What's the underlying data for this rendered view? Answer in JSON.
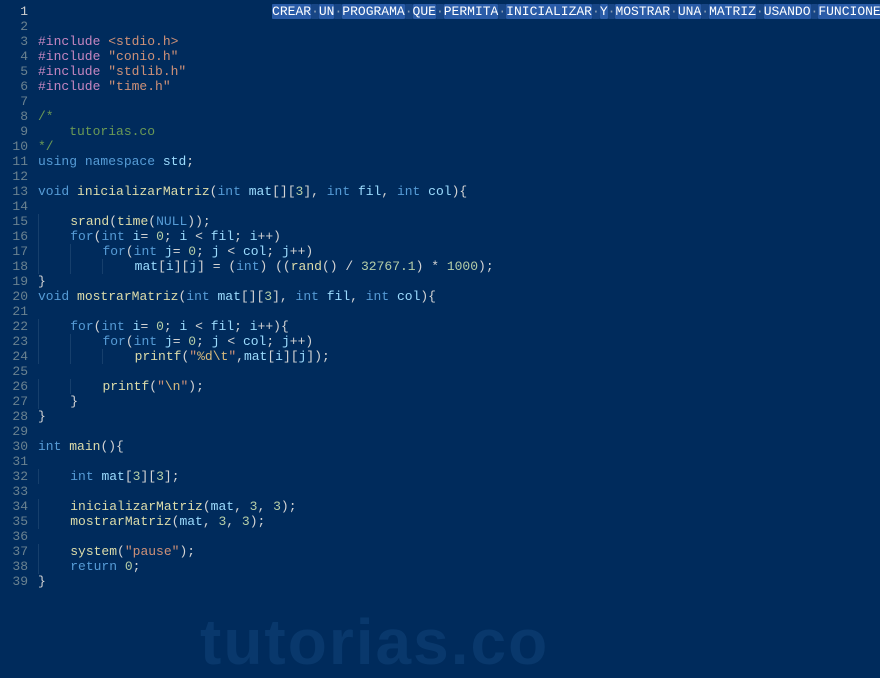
{
  "watermark": "tutorias.co",
  "selection_line": 1,
  "selection_words": [
    "CREAR",
    "UN",
    "PROGRAMA",
    "QUE",
    "PERMITA",
    "INICIALIZAR",
    "Y",
    "MOSTRAR",
    "UNA",
    "MATRIZ",
    "USANDO",
    "FUNCIONES"
  ],
  "lines": [
    {
      "n": 1,
      "tokens": []
    },
    {
      "n": 2,
      "tokens": []
    },
    {
      "n": 3,
      "tokens": [
        {
          "t": "#include ",
          "c": "kw-include"
        },
        {
          "t": "<stdio.h>",
          "c": "anglehdr"
        }
      ]
    },
    {
      "n": 4,
      "tokens": [
        {
          "t": "#include ",
          "c": "kw-include"
        },
        {
          "t": "\"conio.h\"",
          "c": "strhdr"
        }
      ]
    },
    {
      "n": 5,
      "tokens": [
        {
          "t": "#include ",
          "c": "kw-include"
        },
        {
          "t": "\"stdlib.h\"",
          "c": "strhdr"
        }
      ]
    },
    {
      "n": 6,
      "tokens": [
        {
          "t": "#include ",
          "c": "kw-include"
        },
        {
          "t": "\"time.h\"",
          "c": "strhdr"
        }
      ]
    },
    {
      "n": 7,
      "tokens": []
    },
    {
      "n": 8,
      "tokens": [
        {
          "t": "/*",
          "c": "commentblk"
        }
      ]
    },
    {
      "n": 9,
      "tokens": [
        {
          "t": "    tutorias.co",
          "c": "commentblk"
        }
      ]
    },
    {
      "n": 10,
      "tokens": [
        {
          "t": "*/",
          "c": "commentblk"
        }
      ]
    },
    {
      "n": 11,
      "tokens": [
        {
          "t": "using",
          "c": "kw"
        },
        {
          "t": " ",
          "c": "punct"
        },
        {
          "t": "namespace",
          "c": "kw"
        },
        {
          "t": " ",
          "c": "punct"
        },
        {
          "t": "std",
          "c": "ident"
        },
        {
          "t": ";",
          "c": "punct"
        }
      ]
    },
    {
      "n": 12,
      "tokens": []
    },
    {
      "n": 13,
      "tokens": [
        {
          "t": "void",
          "c": "type"
        },
        {
          "t": " ",
          "c": "punct"
        },
        {
          "t": "inicializarMatriz",
          "c": "fn"
        },
        {
          "t": "(",
          "c": "punct"
        },
        {
          "t": "int",
          "c": "type"
        },
        {
          "t": " ",
          "c": "punct"
        },
        {
          "t": "mat",
          "c": "ident"
        },
        {
          "t": "[][",
          "c": "punct"
        },
        {
          "t": "3",
          "c": "num"
        },
        {
          "t": "], ",
          "c": "punct"
        },
        {
          "t": "int",
          "c": "type"
        },
        {
          "t": " ",
          "c": "punct"
        },
        {
          "t": "fil",
          "c": "ident"
        },
        {
          "t": ", ",
          "c": "punct"
        },
        {
          "t": "int",
          "c": "type"
        },
        {
          "t": " ",
          "c": "punct"
        },
        {
          "t": "col",
          "c": "ident"
        },
        {
          "t": "){",
          "c": "punct"
        }
      ]
    },
    {
      "n": 14,
      "tokens": []
    },
    {
      "n": 15,
      "indent": 1,
      "tokens": [
        {
          "t": "srand",
          "c": "fn"
        },
        {
          "t": "(",
          "c": "punct"
        },
        {
          "t": "time",
          "c": "fn"
        },
        {
          "t": "(",
          "c": "punct"
        },
        {
          "t": "NULL",
          "c": "const"
        },
        {
          "t": "));",
          "c": "punct"
        }
      ]
    },
    {
      "n": 16,
      "indent": 1,
      "tokens": [
        {
          "t": "for",
          "c": "kw"
        },
        {
          "t": "(",
          "c": "punct"
        },
        {
          "t": "int",
          "c": "type"
        },
        {
          "t": " ",
          "c": "punct"
        },
        {
          "t": "i",
          "c": "ident"
        },
        {
          "t": "= ",
          "c": "punct"
        },
        {
          "t": "0",
          "c": "num"
        },
        {
          "t": "; ",
          "c": "punct"
        },
        {
          "t": "i",
          "c": "ident"
        },
        {
          "t": " < ",
          "c": "punct"
        },
        {
          "t": "fil",
          "c": "ident"
        },
        {
          "t": "; ",
          "c": "punct"
        },
        {
          "t": "i",
          "c": "ident"
        },
        {
          "t": "++)",
          "c": "punct"
        }
      ]
    },
    {
      "n": 17,
      "indent": 2,
      "tokens": [
        {
          "t": "for",
          "c": "kw"
        },
        {
          "t": "(",
          "c": "punct"
        },
        {
          "t": "int",
          "c": "type"
        },
        {
          "t": " ",
          "c": "punct"
        },
        {
          "t": "j",
          "c": "ident"
        },
        {
          "t": "= ",
          "c": "punct"
        },
        {
          "t": "0",
          "c": "num"
        },
        {
          "t": "; ",
          "c": "punct"
        },
        {
          "t": "j",
          "c": "ident"
        },
        {
          "t": " < ",
          "c": "punct"
        },
        {
          "t": "col",
          "c": "ident"
        },
        {
          "t": "; ",
          "c": "punct"
        },
        {
          "t": "j",
          "c": "ident"
        },
        {
          "t": "++)",
          "c": "punct"
        }
      ]
    },
    {
      "n": 18,
      "indent": 3,
      "tokens": [
        {
          "t": "mat",
          "c": "ident"
        },
        {
          "t": "[",
          "c": "punct"
        },
        {
          "t": "i",
          "c": "ident"
        },
        {
          "t": "][",
          "c": "punct"
        },
        {
          "t": "j",
          "c": "ident"
        },
        {
          "t": "] = (",
          "c": "punct"
        },
        {
          "t": "int",
          "c": "type"
        },
        {
          "t": ") ((",
          "c": "punct"
        },
        {
          "t": "rand",
          "c": "fn"
        },
        {
          "t": "() / ",
          "c": "punct"
        },
        {
          "t": "32767.1",
          "c": "num"
        },
        {
          "t": ") * ",
          "c": "punct"
        },
        {
          "t": "1000",
          "c": "num"
        },
        {
          "t": ");",
          "c": "punct"
        }
      ]
    },
    {
      "n": 19,
      "tokens": [
        {
          "t": "}",
          "c": "punct"
        }
      ]
    },
    {
      "n": 20,
      "tokens": [
        {
          "t": "void",
          "c": "type"
        },
        {
          "t": " ",
          "c": "punct"
        },
        {
          "t": "mostrarMatriz",
          "c": "fn"
        },
        {
          "t": "(",
          "c": "punct"
        },
        {
          "t": "int",
          "c": "type"
        },
        {
          "t": " ",
          "c": "punct"
        },
        {
          "t": "mat",
          "c": "ident"
        },
        {
          "t": "[][",
          "c": "punct"
        },
        {
          "t": "3",
          "c": "num"
        },
        {
          "t": "], ",
          "c": "punct"
        },
        {
          "t": "int",
          "c": "type"
        },
        {
          "t": " ",
          "c": "punct"
        },
        {
          "t": "fil",
          "c": "ident"
        },
        {
          "t": ", ",
          "c": "punct"
        },
        {
          "t": "int",
          "c": "type"
        },
        {
          "t": " ",
          "c": "punct"
        },
        {
          "t": "col",
          "c": "ident"
        },
        {
          "t": "){",
          "c": "punct"
        }
      ]
    },
    {
      "n": 21,
      "tokens": []
    },
    {
      "n": 22,
      "indent": 1,
      "tokens": [
        {
          "t": "for",
          "c": "kw"
        },
        {
          "t": "(",
          "c": "punct"
        },
        {
          "t": "int",
          "c": "type"
        },
        {
          "t": " ",
          "c": "punct"
        },
        {
          "t": "i",
          "c": "ident"
        },
        {
          "t": "= ",
          "c": "punct"
        },
        {
          "t": "0",
          "c": "num"
        },
        {
          "t": "; ",
          "c": "punct"
        },
        {
          "t": "i",
          "c": "ident"
        },
        {
          "t": " < ",
          "c": "punct"
        },
        {
          "t": "fil",
          "c": "ident"
        },
        {
          "t": "; ",
          "c": "punct"
        },
        {
          "t": "i",
          "c": "ident"
        },
        {
          "t": "++){",
          "c": "punct"
        }
      ]
    },
    {
      "n": 23,
      "indent": 2,
      "tokens": [
        {
          "t": "for",
          "c": "kw"
        },
        {
          "t": "(",
          "c": "punct"
        },
        {
          "t": "int",
          "c": "type"
        },
        {
          "t": " ",
          "c": "punct"
        },
        {
          "t": "j",
          "c": "ident"
        },
        {
          "t": "= ",
          "c": "punct"
        },
        {
          "t": "0",
          "c": "num"
        },
        {
          "t": "; ",
          "c": "punct"
        },
        {
          "t": "j",
          "c": "ident"
        },
        {
          "t": " < ",
          "c": "punct"
        },
        {
          "t": "col",
          "c": "ident"
        },
        {
          "t": "; ",
          "c": "punct"
        },
        {
          "t": "j",
          "c": "ident"
        },
        {
          "t": "++)",
          "c": "punct"
        }
      ]
    },
    {
      "n": 24,
      "indent": 3,
      "tokens": [
        {
          "t": "printf",
          "c": "fn"
        },
        {
          "t": "(",
          "c": "punct"
        },
        {
          "t": "\"",
          "c": "str"
        },
        {
          "t": "%d",
          "c": "esc"
        },
        {
          "t": "\\t",
          "c": "esc"
        },
        {
          "t": "\"",
          "c": "str"
        },
        {
          "t": ",",
          "c": "punct"
        },
        {
          "t": "mat",
          "c": "ident"
        },
        {
          "t": "[",
          "c": "punct"
        },
        {
          "t": "i",
          "c": "ident"
        },
        {
          "t": "][",
          "c": "punct"
        },
        {
          "t": "j",
          "c": "ident"
        },
        {
          "t": "]);",
          "c": "punct"
        }
      ]
    },
    {
      "n": 25,
      "tokens": []
    },
    {
      "n": 26,
      "indent": 2,
      "tokens": [
        {
          "t": "printf",
          "c": "fn"
        },
        {
          "t": "(",
          "c": "punct"
        },
        {
          "t": "\"",
          "c": "str"
        },
        {
          "t": "\\n",
          "c": "esc"
        },
        {
          "t": "\"",
          "c": "str"
        },
        {
          "t": ");",
          "c": "punct"
        }
      ]
    },
    {
      "n": 27,
      "indent": 1,
      "tokens": [
        {
          "t": "}",
          "c": "punct"
        }
      ]
    },
    {
      "n": 28,
      "tokens": [
        {
          "t": "}",
          "c": "punct"
        }
      ]
    },
    {
      "n": 29,
      "tokens": []
    },
    {
      "n": 30,
      "tokens": [
        {
          "t": "int",
          "c": "type"
        },
        {
          "t": " ",
          "c": "punct"
        },
        {
          "t": "main",
          "c": "fn"
        },
        {
          "t": "(){",
          "c": "punct"
        }
      ]
    },
    {
      "n": 31,
      "tokens": []
    },
    {
      "n": 32,
      "indent": 1,
      "tokens": [
        {
          "t": "int",
          "c": "type"
        },
        {
          "t": " ",
          "c": "punct"
        },
        {
          "t": "mat",
          "c": "ident"
        },
        {
          "t": "[",
          "c": "punct"
        },
        {
          "t": "3",
          "c": "num"
        },
        {
          "t": "][",
          "c": "punct"
        },
        {
          "t": "3",
          "c": "num"
        },
        {
          "t": "];",
          "c": "punct"
        }
      ]
    },
    {
      "n": 33,
      "tokens": []
    },
    {
      "n": 34,
      "indent": 1,
      "tokens": [
        {
          "t": "inicializarMatriz",
          "c": "fn"
        },
        {
          "t": "(",
          "c": "punct"
        },
        {
          "t": "mat",
          "c": "ident"
        },
        {
          "t": ", ",
          "c": "punct"
        },
        {
          "t": "3",
          "c": "num"
        },
        {
          "t": ", ",
          "c": "punct"
        },
        {
          "t": "3",
          "c": "num"
        },
        {
          "t": ");",
          "c": "punct"
        }
      ]
    },
    {
      "n": 35,
      "indent": 1,
      "tokens": [
        {
          "t": "mostrarMatriz",
          "c": "fn"
        },
        {
          "t": "(",
          "c": "punct"
        },
        {
          "t": "mat",
          "c": "ident"
        },
        {
          "t": ", ",
          "c": "punct"
        },
        {
          "t": "3",
          "c": "num"
        },
        {
          "t": ", ",
          "c": "punct"
        },
        {
          "t": "3",
          "c": "num"
        },
        {
          "t": ");",
          "c": "punct"
        }
      ]
    },
    {
      "n": 36,
      "tokens": []
    },
    {
      "n": 37,
      "indent": 1,
      "tokens": [
        {
          "t": "system",
          "c": "fn"
        },
        {
          "t": "(",
          "c": "punct"
        },
        {
          "t": "\"pause\"",
          "c": "str"
        },
        {
          "t": ");",
          "c": "punct"
        }
      ]
    },
    {
      "n": 38,
      "indent": 1,
      "tokens": [
        {
          "t": "return",
          "c": "kw"
        },
        {
          "t": " ",
          "c": "punct"
        },
        {
          "t": "0",
          "c": "num"
        },
        {
          "t": ";",
          "c": "punct"
        }
      ]
    },
    {
      "n": 39,
      "tokens": [
        {
          "t": "}",
          "c": "punct"
        }
      ]
    }
  ]
}
